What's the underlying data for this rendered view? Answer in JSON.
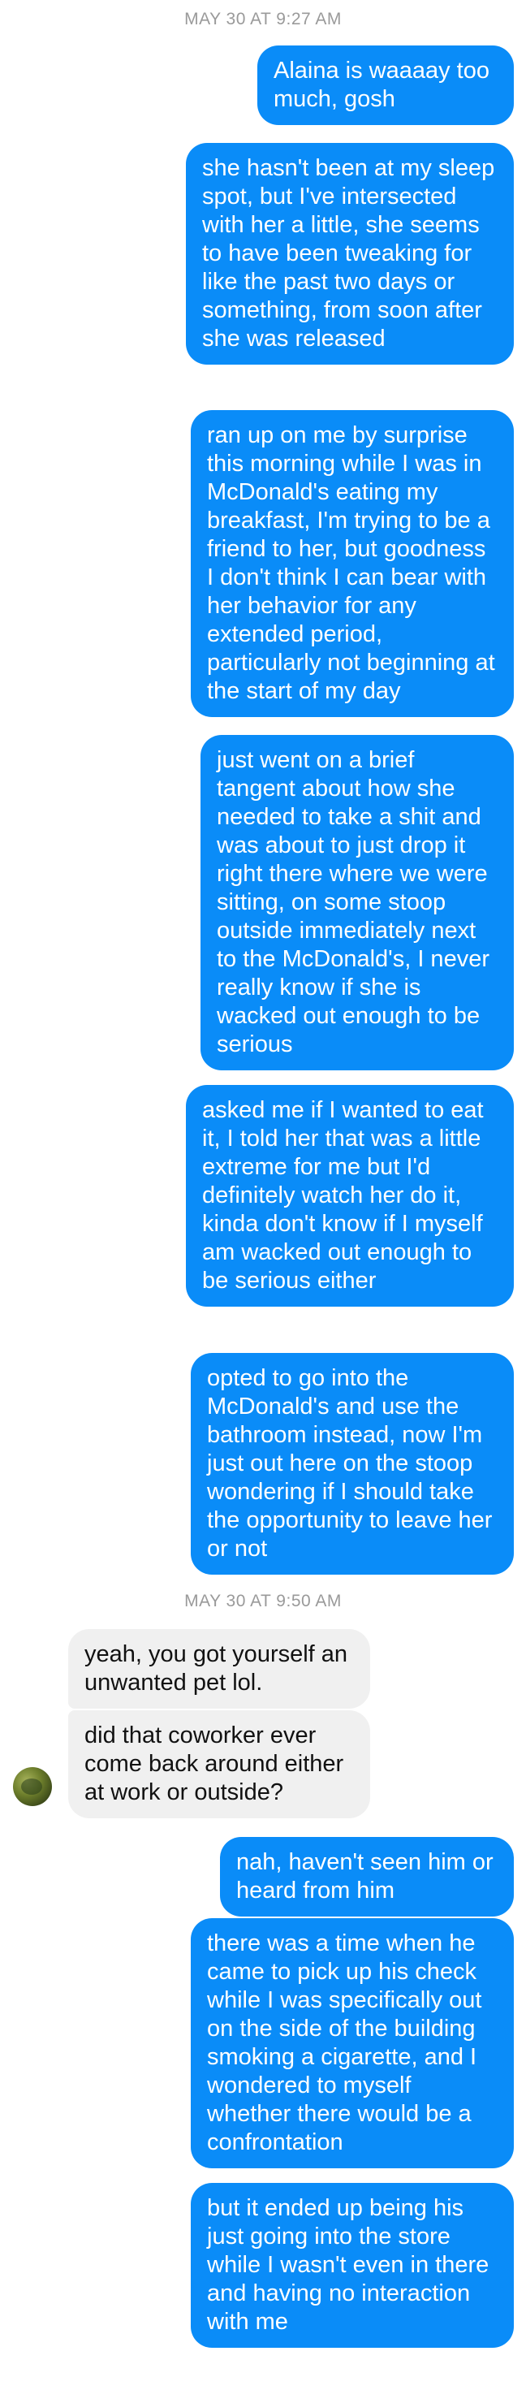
{
  "conversation": {
    "timestamps": [
      "MAY 30 AT 9:27 AM",
      "MAY 30 AT 9:50 AM"
    ],
    "messages": [
      {
        "sender": "me",
        "text": "Alaina is waaaay too much, gosh"
      },
      {
        "sender": "me",
        "text": "she hasn't been at my sleep spot, but I've intersected with her a little, she seems to have been tweaking for like the past two days or something, from soon after she was released"
      },
      {
        "sender": "me",
        "text": "ran up on me by surprise this morning while I was in McDonald's eating my breakfast, I'm trying to be a friend to her, but goodness I don't think I can bear with her behavior for any extended period, particularly not beginning at the start of my day"
      },
      {
        "sender": "me",
        "text": "just went on a brief tangent about how she needed to take a shit and was about to just drop it right there where we were sitting, on some stoop outside immediately next to the McDonald's, I never really know if she is wacked out enough to be serious"
      },
      {
        "sender": "me",
        "text": "asked me if I wanted to eat it, I told her that was a little extreme for me but I'd definitely watch her do it, kinda don't know if I myself am wacked out enough to be serious either"
      },
      {
        "sender": "me",
        "text": "opted to go into the McDonald's and use the bathroom instead, now I'm just out here on the stoop wondering if I should take the opportunity to leave her or not"
      },
      {
        "sender": "them",
        "text": "yeah, you got yourself an unwanted pet lol."
      },
      {
        "sender": "them",
        "text": "did that coworker ever come back around either at work or outside?"
      },
      {
        "sender": "me",
        "text": "nah, haven't seen him or heard from him"
      },
      {
        "sender": "me",
        "text": "there was a time when he came to pick up his check while I was specifically out on the side of the building smoking a cigarette, and I wondered to myself whether there would be a confrontation"
      },
      {
        "sender": "me",
        "text": "but it ended up being his just going into the store while I wasn't even in there and having no interaction with me"
      }
    ]
  },
  "colors": {
    "outgoing_bubble": "#0a8cf8",
    "incoming_bubble": "#f0f0f0",
    "timestamp_text": "#9a9a9a"
  },
  "icons": {
    "contact_avatar": "avatar-photo"
  }
}
